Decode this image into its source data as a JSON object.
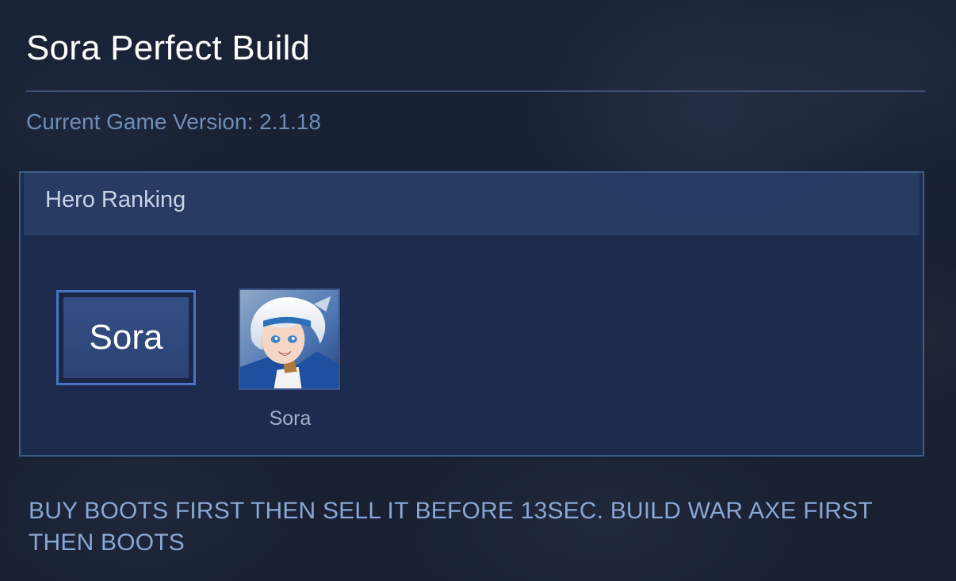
{
  "page": {
    "title": "Sora Perfect Build",
    "version_label": "Current Game Version: ",
    "version": "2.1.18"
  },
  "ranking": {
    "title": "Hero Ranking",
    "hero_button_label": "Sora",
    "hero": {
      "name": "Sora",
      "portrait_icon": "hero-portrait-sora"
    }
  },
  "build_tip": "BUY BOOTS FIRST THEN SELL IT BEFORE 13SEC. BUILD WAR AXE FIRST THEN BOOTS",
  "colors": {
    "background": "#1d2538",
    "panel": "#1e2e52",
    "panel_border": "#3f5c86",
    "accent_blue": "#4a74c2",
    "version_text": "#6f8db5",
    "tip_text": "#8aa6d2"
  }
}
